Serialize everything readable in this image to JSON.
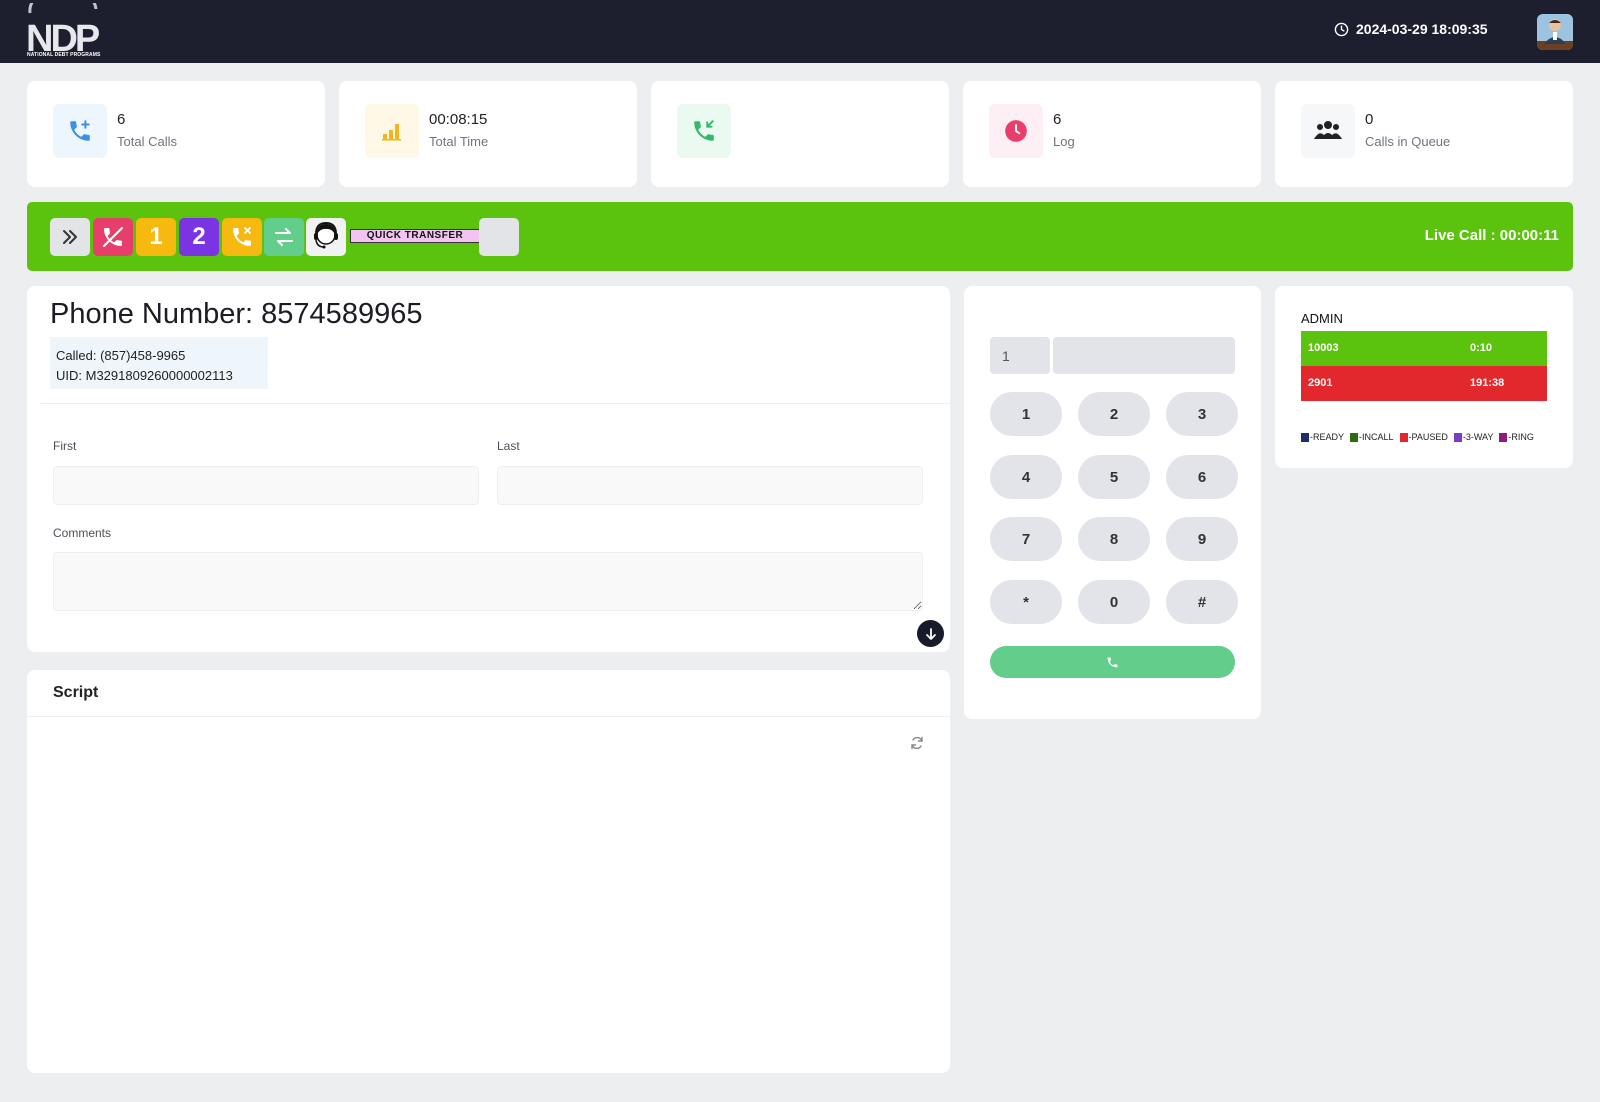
{
  "header": {
    "logo_text": "NATIONAL DEBT PROGRAMS",
    "datetime": "2024-03-29 18:09:35"
  },
  "stats": [
    {
      "value": "6",
      "label": "Total Calls",
      "icon": "phone-plus-icon",
      "color": "#3b8fe6",
      "bg": "#eef6fd"
    },
    {
      "value": "00:08:15",
      "label": "Total Time",
      "icon": "bar-chart-icon",
      "color": "#f2b51c",
      "bg": "#fff8e6"
    },
    {
      "value": "",
      "label": "",
      "icon": "phone-incoming-icon",
      "color": "#33b86c",
      "bg": "#eafaf1"
    },
    {
      "value": "6",
      "label": "Log",
      "icon": "clock-icon",
      "color": "#e83e6b",
      "bg": "#fdeff3"
    },
    {
      "value": "0",
      "label": "Calls in Queue",
      "icon": "users-icon",
      "color": "#222222",
      "bg": "#f6f7f8"
    }
  ],
  "toolbar": {
    "quick_transfer": "QUICK TRANSFER",
    "line1": "1",
    "line2": "2",
    "live_call": "Live Call : 00:00:11"
  },
  "phone": {
    "title": "Phone Number: 8574589965",
    "called": "Called: (857)458-9965",
    "uid": "UID: M3291809260000002113"
  },
  "form": {
    "first_label": "First",
    "first_value": "",
    "last_label": "Last",
    "last_value": "",
    "comments_label": "Comments",
    "comments_value": ""
  },
  "script": {
    "title": "Script"
  },
  "dialpad": {
    "prefix_value": "1",
    "number_value": "",
    "keys": [
      "1",
      "2",
      "3",
      "4",
      "5",
      "6",
      "7",
      "8",
      "9",
      "*",
      "0",
      "#"
    ]
  },
  "admin": {
    "title": "ADMIN",
    "rows": [
      {
        "ext": "10003",
        "time": "0:10",
        "color": "#5bc20e"
      },
      {
        "ext": "2901",
        "time": "191:38",
        "color": "#e2282c"
      }
    ],
    "legend": [
      {
        "label": "-READY",
        "color": "#1e2f6b"
      },
      {
        "label": "-INCALL",
        "color": "#2d6a12"
      },
      {
        "label": "-PAUSED",
        "color": "#e2282c"
      },
      {
        "label": "-3-WAY",
        "color": "#7a3bc9"
      },
      {
        "label": "-RING",
        "color": "#8a1e7a"
      }
    ]
  }
}
